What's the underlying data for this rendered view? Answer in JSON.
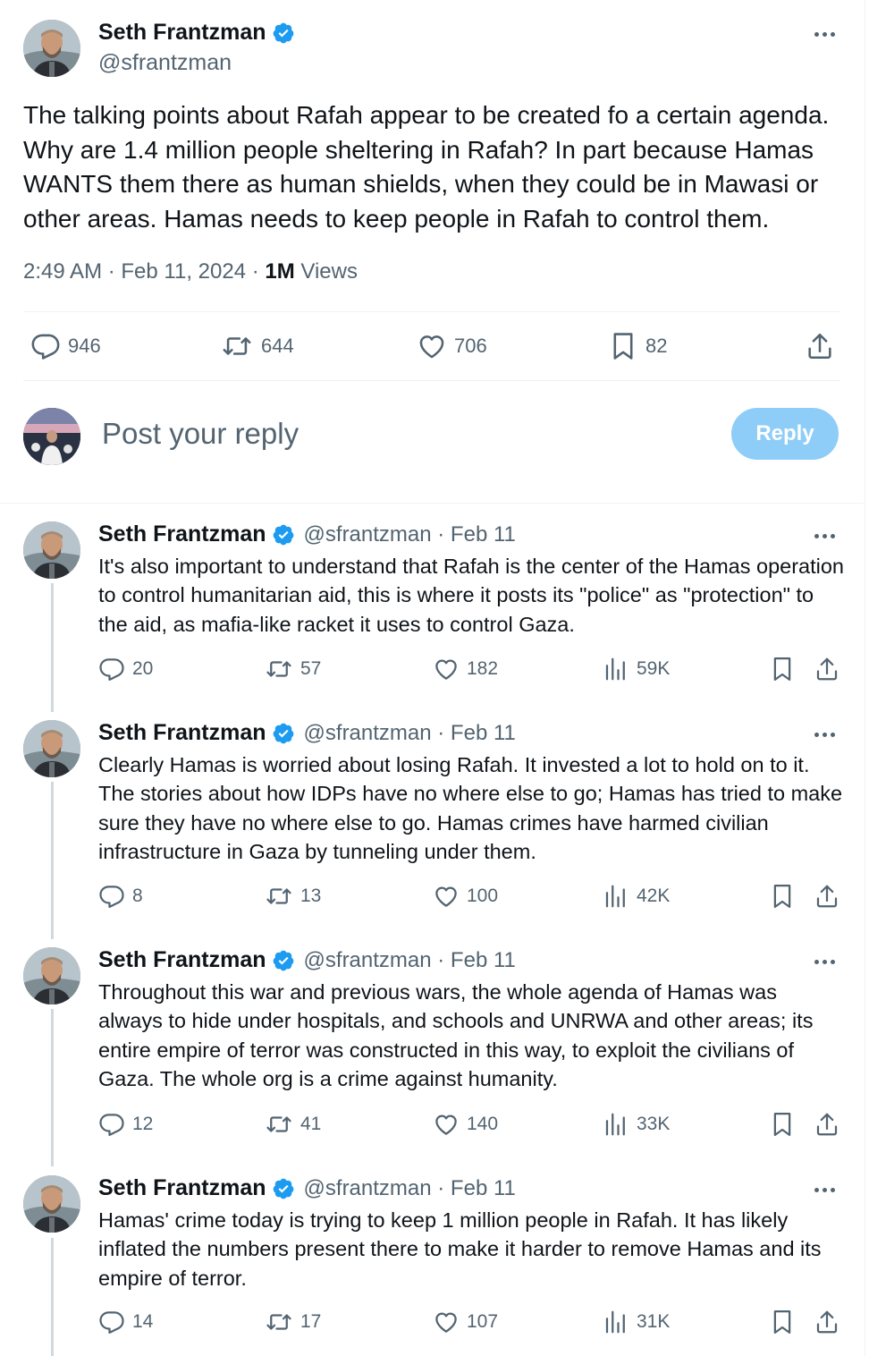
{
  "main_tweet": {
    "author_name": "Seth Frantzman",
    "author_handle": "@sfrantzman",
    "body": "The talking points about Rafah appear to be created fo a certain agenda. Why are 1.4 million people sheltering in Rafah? In part because Hamas WANTS them there as human shields, when they could be in Mawasi or other areas. Hamas needs to keep people in Rafah to control them.",
    "timestamp": "2:49 AM · Feb 11, 2024 · ",
    "views_count": "1M",
    "views_label": " Views",
    "replies": "946",
    "reposts": "644",
    "likes": "706",
    "bookmarks": "82"
  },
  "composer": {
    "placeholder": "Post your reply",
    "button_label": "Reply"
  },
  "replies": [
    {
      "author_name": "Seth Frantzman",
      "handle_date": "@sfrantzman · Feb 11",
      "body": "It's also important to understand that Rafah is the center of the Hamas operation to control humanitarian aid, this is where it posts its \"police\" as \"protection\" to the aid, as mafia-like racket it uses to control Gaza.",
      "replies": "20",
      "reposts": "57",
      "likes": "182",
      "views": "59K"
    },
    {
      "author_name": "Seth Frantzman",
      "handle_date": "@sfrantzman · Feb 11",
      "body": "Clearly Hamas is worried about losing Rafah. It invested a lot to hold on to it. The stories about how IDPs have no where else to go; Hamas has tried to make sure they have no where else to go. Hamas crimes have harmed civilian infrastructure in Gaza by tunneling under them.",
      "replies": "8",
      "reposts": "13",
      "likes": "100",
      "views": "42K"
    },
    {
      "author_name": "Seth Frantzman",
      "handle_date": "@sfrantzman · Feb 11",
      "body": "Throughout this war and previous wars, the whole agenda of Hamas was always to hide under hospitals, and schools and UNRWA and other areas; its entire empire of terror was constructed in this way, to exploit the civilians of Gaza. The whole org is a crime against humanity.",
      "replies": "12",
      "reposts": "41",
      "likes": "140",
      "views": "33K"
    },
    {
      "author_name": "Seth Frantzman",
      "handle_date": "@sfrantzman · Feb 11",
      "body": "Hamas' crime today is trying to keep 1 million people in Rafah. It has likely inflated the numbers present there to make it harder to remove Hamas and its empire of terror.",
      "replies": "14",
      "reposts": "17",
      "likes": "107",
      "views": "31K"
    }
  ],
  "colors": {
    "text_primary": "#0f1419",
    "text_secondary": "#536471",
    "verified_blue": "#1d9bf0",
    "reply_button_disabled": "#8ecdf8",
    "divider": "#eff3f4",
    "thread_line": "#cfd9de"
  },
  "icons": [
    "avatar",
    "verified-badge-icon",
    "more-icon",
    "reply-icon",
    "repost-icon",
    "like-icon",
    "bookmark-icon",
    "share-icon",
    "views-icon"
  ]
}
